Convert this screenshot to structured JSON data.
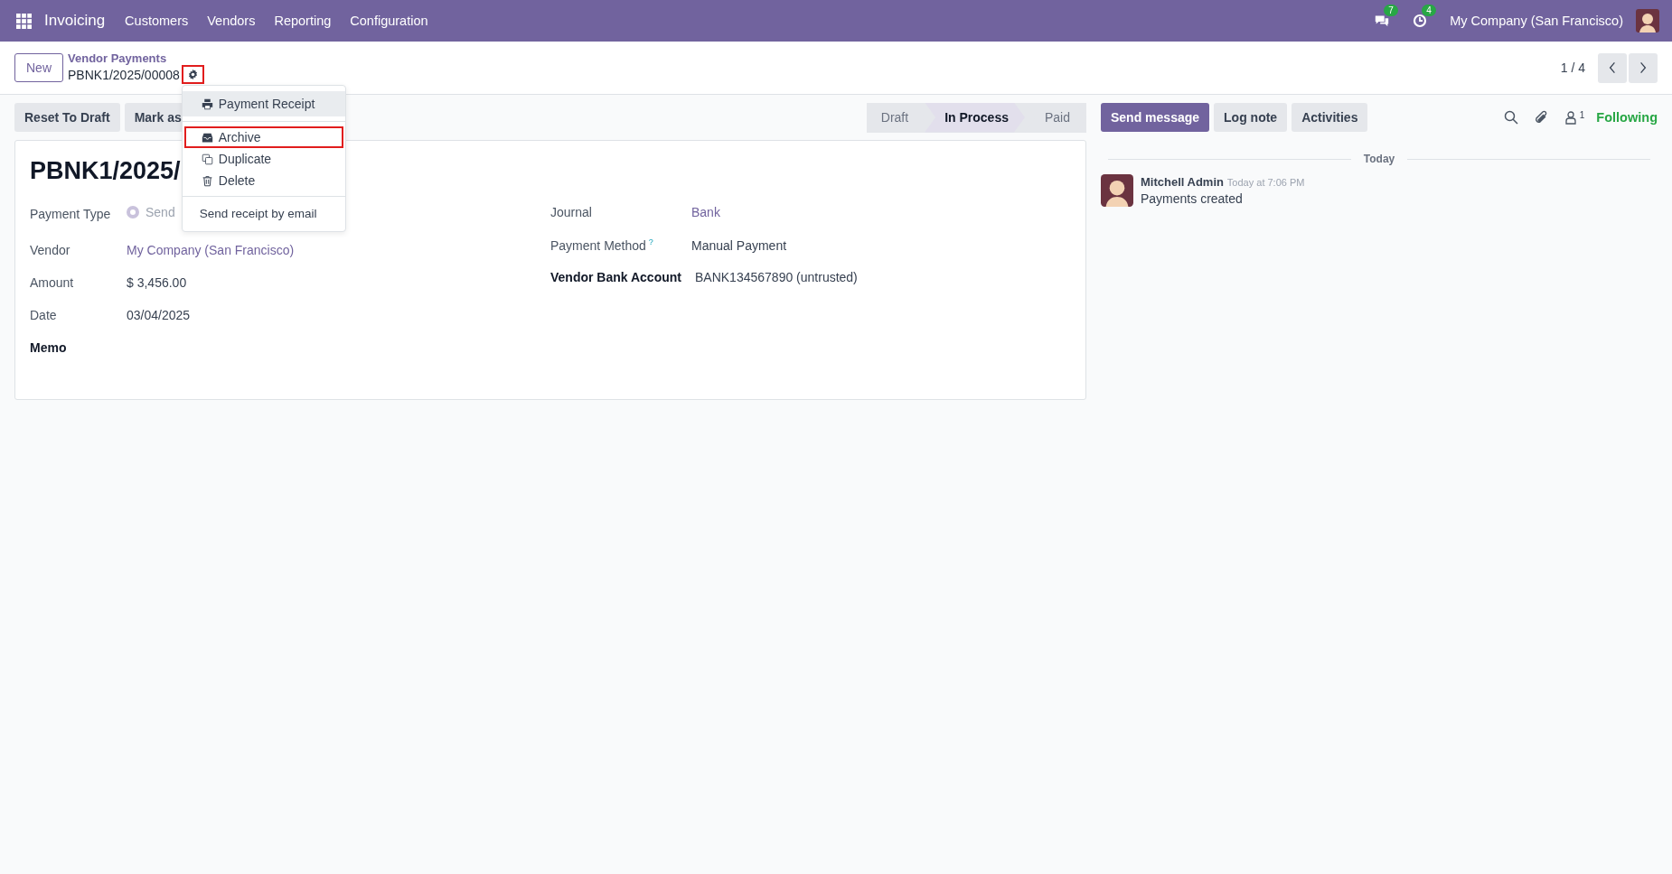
{
  "navbar": {
    "app": "Invoicing",
    "menu": [
      "Customers",
      "Vendors",
      "Reporting",
      "Configuration"
    ],
    "messages_badge": "7",
    "activities_badge": "4",
    "company": "My Company (San Francisco)"
  },
  "control_panel": {
    "new_button": "New",
    "breadcrumb": "Vendor Payments",
    "record": "PBNK1/2025/00008",
    "gear_highlighted": true,
    "pager": "1 / 4"
  },
  "actions": [
    "Reset To Draft",
    "Mark as"
  ],
  "statusbar": [
    {
      "label": "Draft",
      "selected": false
    },
    {
      "label": "In Process",
      "selected": true
    },
    {
      "label": "Paid",
      "selected": false
    }
  ],
  "gear_menu": [
    {
      "kind": "print",
      "label": "Payment Receipt",
      "highlighted": false,
      "hovered": true
    },
    {
      "kind": "divider"
    },
    {
      "kind": "archive",
      "label": "Archive",
      "highlighted": true,
      "hovered": false
    },
    {
      "kind": "duplicate",
      "label": "Duplicate",
      "highlighted": false,
      "hovered": false
    },
    {
      "kind": "delete",
      "label": "Delete",
      "highlighted": false,
      "hovered": false
    },
    {
      "kind": "divider"
    },
    {
      "kind": "plain",
      "label": "Send receipt by email",
      "highlighted": false,
      "hovered": false
    }
  ],
  "form": {
    "title": "PBNK1/2025/",
    "left": [
      {
        "label": "Payment Type",
        "value": "Send",
        "kind": "radio",
        "checked": true
      },
      {
        "label": "Vendor",
        "value": "My Company (San Francisco)",
        "kind": "link"
      },
      {
        "label": "Amount",
        "value": "$ 3,456.00",
        "kind": "text"
      },
      {
        "label": "Date",
        "value": "03/04/2025",
        "kind": "text"
      },
      {
        "label": "Memo",
        "kind": "bold"
      }
    ],
    "right": [
      {
        "label": "Journal",
        "value": "Bank",
        "kind": "link"
      },
      {
        "label": "Payment Method",
        "help": "?",
        "value": "Manual Payment",
        "kind": "text"
      },
      {
        "label": "Vendor Bank Account",
        "value": "BANK134567890 (untrusted)",
        "kind": "bold"
      }
    ]
  },
  "chatter": {
    "buttons": [
      {
        "label": "Send message",
        "selected": true
      },
      {
        "label": "Log note",
        "selected": false
      },
      {
        "label": "Activities",
        "selected": false
      }
    ],
    "followers_count": "1",
    "following": "Following",
    "separator": "Today",
    "messages": [
      {
        "author": "Mitchell Admin",
        "time": "Today at 7:06 PM",
        "body": "Payments created"
      }
    ]
  }
}
